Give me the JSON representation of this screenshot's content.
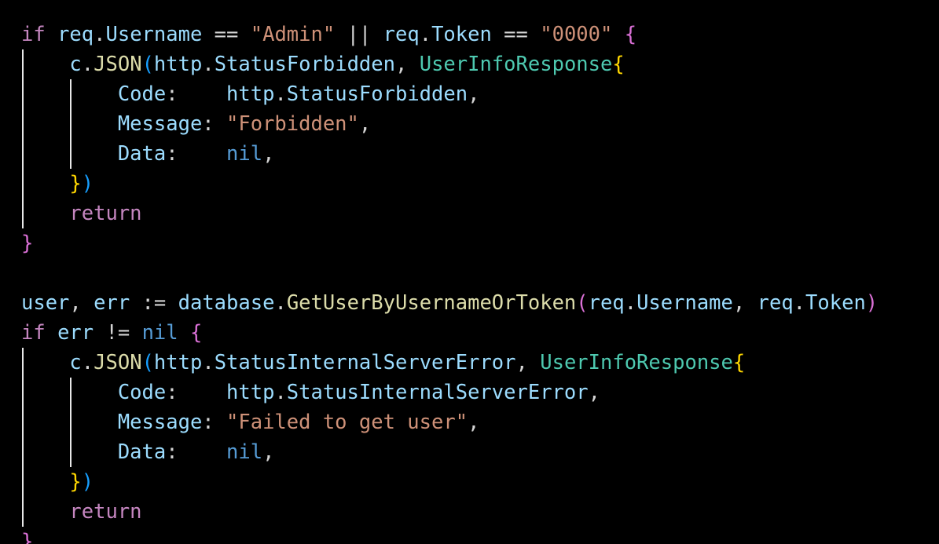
{
  "editor": {
    "theme": "dark",
    "colors": {
      "background": "#000000",
      "keyword": "#c586c0",
      "variable": "#9cdcfe",
      "string": "#ce9178",
      "function": "#dcdcaa",
      "type": "#4ec9b0",
      "constant": "#569cd6",
      "bracket_level1": "#ffd700",
      "bracket_level2": "#da70d6",
      "indent_guide": "#e8e8e8"
    },
    "lines": [
      {
        "tokens": [
          {
            "text": "if",
            "kind": "kw"
          },
          {
            "text": " ",
            "kind": "plain"
          },
          {
            "text": "req",
            "kind": "var"
          },
          {
            "text": ".",
            "kind": "plain"
          },
          {
            "text": "Username",
            "kind": "var"
          },
          {
            "text": " == ",
            "kind": "plain"
          },
          {
            "text": "\"Admin\"",
            "kind": "str"
          },
          {
            "text": " || ",
            "kind": "plain"
          },
          {
            "text": "req",
            "kind": "var"
          },
          {
            "text": ".",
            "kind": "plain"
          },
          {
            "text": "Token",
            "kind": "var"
          },
          {
            "text": " == ",
            "kind": "plain"
          },
          {
            "text": "\"0000\"",
            "kind": "str"
          },
          {
            "text": " ",
            "kind": "plain"
          },
          {
            "text": "{",
            "kind": "b2"
          }
        ]
      },
      {
        "tokens": [
          {
            "text": "    ",
            "kind": "plain"
          },
          {
            "text": "c",
            "kind": "var"
          },
          {
            "text": ".",
            "kind": "plain"
          },
          {
            "text": "JSON",
            "kind": "fn"
          },
          {
            "text": "(",
            "kind": "b3"
          },
          {
            "text": "http",
            "kind": "var"
          },
          {
            "text": ".",
            "kind": "plain"
          },
          {
            "text": "StatusForbidden",
            "kind": "var"
          },
          {
            "text": ", ",
            "kind": "plain"
          },
          {
            "text": "UserInfoResponse",
            "kind": "type"
          },
          {
            "text": "{",
            "kind": "b1"
          }
        ]
      },
      {
        "tokens": [
          {
            "text": "        ",
            "kind": "plain"
          },
          {
            "text": "Code",
            "kind": "var"
          },
          {
            "text": ":    ",
            "kind": "plain"
          },
          {
            "text": "http",
            "kind": "var"
          },
          {
            "text": ".",
            "kind": "plain"
          },
          {
            "text": "StatusForbidden",
            "kind": "var"
          },
          {
            "text": ",",
            "kind": "plain"
          }
        ]
      },
      {
        "tokens": [
          {
            "text": "        ",
            "kind": "plain"
          },
          {
            "text": "Message",
            "kind": "var"
          },
          {
            "text": ": ",
            "kind": "plain"
          },
          {
            "text": "\"Forbidden\"",
            "kind": "str"
          },
          {
            "text": ",",
            "kind": "plain"
          }
        ]
      },
      {
        "tokens": [
          {
            "text": "        ",
            "kind": "plain"
          },
          {
            "text": "Data",
            "kind": "var"
          },
          {
            "text": ":    ",
            "kind": "plain"
          },
          {
            "text": "nil",
            "kind": "const"
          },
          {
            "text": ",",
            "kind": "plain"
          }
        ]
      },
      {
        "tokens": [
          {
            "text": "    ",
            "kind": "plain"
          },
          {
            "text": "}",
            "kind": "b1"
          },
          {
            "text": ")",
            "kind": "b3"
          }
        ]
      },
      {
        "tokens": [
          {
            "text": "    ",
            "kind": "plain"
          },
          {
            "text": "return",
            "kind": "kw"
          }
        ]
      },
      {
        "tokens": [
          {
            "text": "}",
            "kind": "b2"
          }
        ]
      },
      {
        "tokens": []
      },
      {
        "tokens": [
          {
            "text": "user",
            "kind": "var"
          },
          {
            "text": ", ",
            "kind": "plain"
          },
          {
            "text": "err",
            "kind": "var"
          },
          {
            "text": " := ",
            "kind": "plain"
          },
          {
            "text": "database",
            "kind": "var"
          },
          {
            "text": ".",
            "kind": "plain"
          },
          {
            "text": "GetUserByUsernameOrToken",
            "kind": "fn"
          },
          {
            "text": "(",
            "kind": "b2"
          },
          {
            "text": "req",
            "kind": "var"
          },
          {
            "text": ".",
            "kind": "plain"
          },
          {
            "text": "Username",
            "kind": "var"
          },
          {
            "text": ", ",
            "kind": "plain"
          },
          {
            "text": "req",
            "kind": "var"
          },
          {
            "text": ".",
            "kind": "plain"
          },
          {
            "text": "Token",
            "kind": "var"
          },
          {
            "text": ")",
            "kind": "b2"
          }
        ]
      },
      {
        "tokens": [
          {
            "text": "if",
            "kind": "kw"
          },
          {
            "text": " ",
            "kind": "plain"
          },
          {
            "text": "err",
            "kind": "var"
          },
          {
            "text": " != ",
            "kind": "plain"
          },
          {
            "text": "nil",
            "kind": "const"
          },
          {
            "text": " ",
            "kind": "plain"
          },
          {
            "text": "{",
            "kind": "b2"
          }
        ]
      },
      {
        "tokens": [
          {
            "text": "    ",
            "kind": "plain"
          },
          {
            "text": "c",
            "kind": "var"
          },
          {
            "text": ".",
            "kind": "plain"
          },
          {
            "text": "JSON",
            "kind": "fn"
          },
          {
            "text": "(",
            "kind": "b3"
          },
          {
            "text": "http",
            "kind": "var"
          },
          {
            "text": ".",
            "kind": "plain"
          },
          {
            "text": "StatusInternalServerError",
            "kind": "var"
          },
          {
            "text": ", ",
            "kind": "plain"
          },
          {
            "text": "UserInfoResponse",
            "kind": "type"
          },
          {
            "text": "{",
            "kind": "b1"
          }
        ]
      },
      {
        "tokens": [
          {
            "text": "        ",
            "kind": "plain"
          },
          {
            "text": "Code",
            "kind": "var"
          },
          {
            "text": ":    ",
            "kind": "plain"
          },
          {
            "text": "http",
            "kind": "var"
          },
          {
            "text": ".",
            "kind": "plain"
          },
          {
            "text": "StatusInternalServerError",
            "kind": "var"
          },
          {
            "text": ",",
            "kind": "plain"
          }
        ]
      },
      {
        "tokens": [
          {
            "text": "        ",
            "kind": "plain"
          },
          {
            "text": "Message",
            "kind": "var"
          },
          {
            "text": ": ",
            "kind": "plain"
          },
          {
            "text": "\"Failed to get user\"",
            "kind": "str"
          },
          {
            "text": ",",
            "kind": "plain"
          }
        ]
      },
      {
        "tokens": [
          {
            "text": "        ",
            "kind": "plain"
          },
          {
            "text": "Data",
            "kind": "var"
          },
          {
            "text": ":    ",
            "kind": "plain"
          },
          {
            "text": "nil",
            "kind": "const"
          },
          {
            "text": ",",
            "kind": "plain"
          }
        ]
      },
      {
        "tokens": [
          {
            "text": "    ",
            "kind": "plain"
          },
          {
            "text": "}",
            "kind": "b1"
          },
          {
            "text": ")",
            "kind": "b3"
          }
        ]
      },
      {
        "tokens": [
          {
            "text": "    ",
            "kind": "plain"
          },
          {
            "text": "return",
            "kind": "kw"
          }
        ]
      },
      {
        "tokens": [
          {
            "text": "}",
            "kind": "b2"
          }
        ]
      }
    ]
  }
}
